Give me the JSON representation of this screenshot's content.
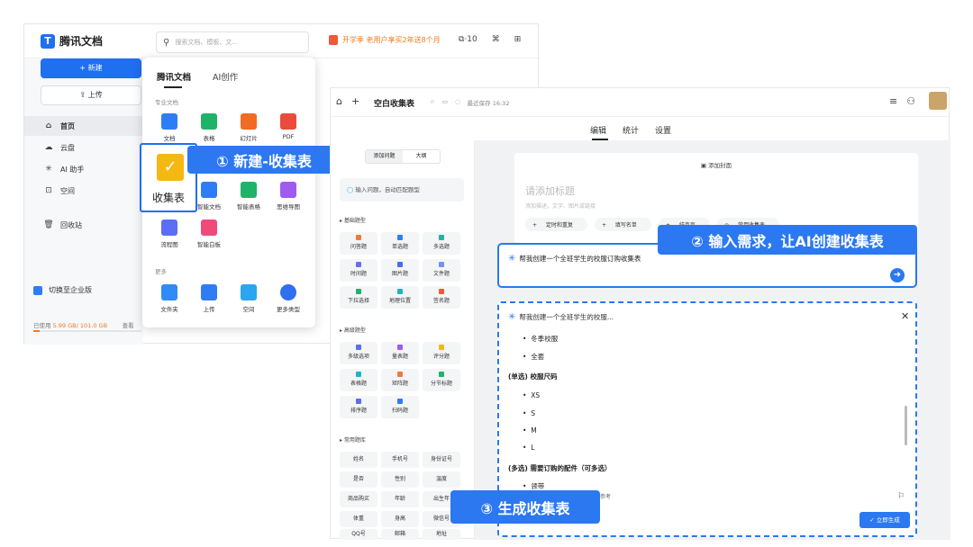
{
  "app": {
    "name": "腾讯文档"
  },
  "search": {
    "placeholder": "搜索文档、模板、文..."
  },
  "promo": "开学季 老用户享买2年送8个月",
  "toolbar_count": "·10",
  "sidebar": {
    "new_label": "+ 新建",
    "upload_label": "上传",
    "items": [
      {
        "label": "首页",
        "icon": "home-icon"
      },
      {
        "label": "云盘",
        "icon": "cloud-icon"
      },
      {
        "label": "AI 助手",
        "icon": "ai-icon"
      },
      {
        "label": "空间",
        "icon": "space-icon"
      },
      {
        "label": "回收站",
        "icon": "trash-icon"
      }
    ],
    "enterprise": "切换至企业版",
    "storage_used": "已使用",
    "storage_value": "5.99 GB",
    "storage_total": "/ 101.0 GB",
    "storage_view": "查看",
    "storage_fraction": 0.059
  },
  "dropdown": {
    "tab1": "腾讯文档",
    "tab2": "AI创作",
    "section_pro": "专业文档",
    "pro_items": [
      "文档",
      "表格",
      "幻灯片",
      "PDF"
    ],
    "row2_items": [
      "智能文档",
      "智能表格",
      "思维导图"
    ],
    "row3_items": [
      "流程图",
      "智能白板"
    ],
    "section_more": "更多",
    "more_items": [
      "文件夹",
      "上传",
      "空间",
      "更多类型"
    ],
    "highlight_label": "收集表"
  },
  "callouts": {
    "c1": "① 新建-收集表",
    "c2": "② 输入需求，让AI创建收集表",
    "c3": "③ 生成收集表"
  },
  "editor": {
    "title": "空白收集表",
    "saved": "最近保存 16:32",
    "tabs": [
      "编辑",
      "统计",
      "设置"
    ],
    "toggle": [
      "添加问题",
      "大纲"
    ],
    "ai_input": "输入问题，自动匹配题型",
    "basic_label": "基础题型",
    "basic": [
      "问答题",
      "单选题",
      "多选题",
      "时间题",
      "图片题",
      "文件题",
      "下拉选择",
      "地理位置",
      "签名题"
    ],
    "advanced_label": "高级题型",
    "advanced": [
      "多级选项",
      "量表题",
      "评分题",
      "表格题",
      "矩阵题",
      "分节标题",
      "排序题",
      "扫码题"
    ],
    "common_label": "常用题库",
    "common": [
      "姓名",
      "手机号",
      "身份证号",
      "是否",
      "性别",
      "温度",
      "商品购买",
      "年龄",
      "出生年",
      "体重",
      "身高",
      "微信号",
      "QQ号",
      "邮箱",
      "地址"
    ],
    "cover": "添加封面",
    "form_title_placeholder": "请添加标题",
    "form_desc_placeholder": "添加描述，文字、图片或链接",
    "form_buttons": [
      "定时和重复",
      "填写名单",
      "结束页",
      "常用收集表"
    ]
  },
  "prompt": {
    "text": "帮我创建一个全班学生的校服订购收集表"
  },
  "generated": {
    "header": "帮我创建一个全班学生的校服...",
    "items_a": [
      "冬季校服",
      "全套"
    ],
    "heading1": "(单选) 校服尺码",
    "sizes": [
      "XS",
      "S",
      "M",
      "L"
    ],
    "heading2": "(多选) 需要订购的配件（可多选）",
    "items_b": [
      "领带"
    ],
    "hint": "，仅供参考",
    "apply": "立即生成"
  }
}
